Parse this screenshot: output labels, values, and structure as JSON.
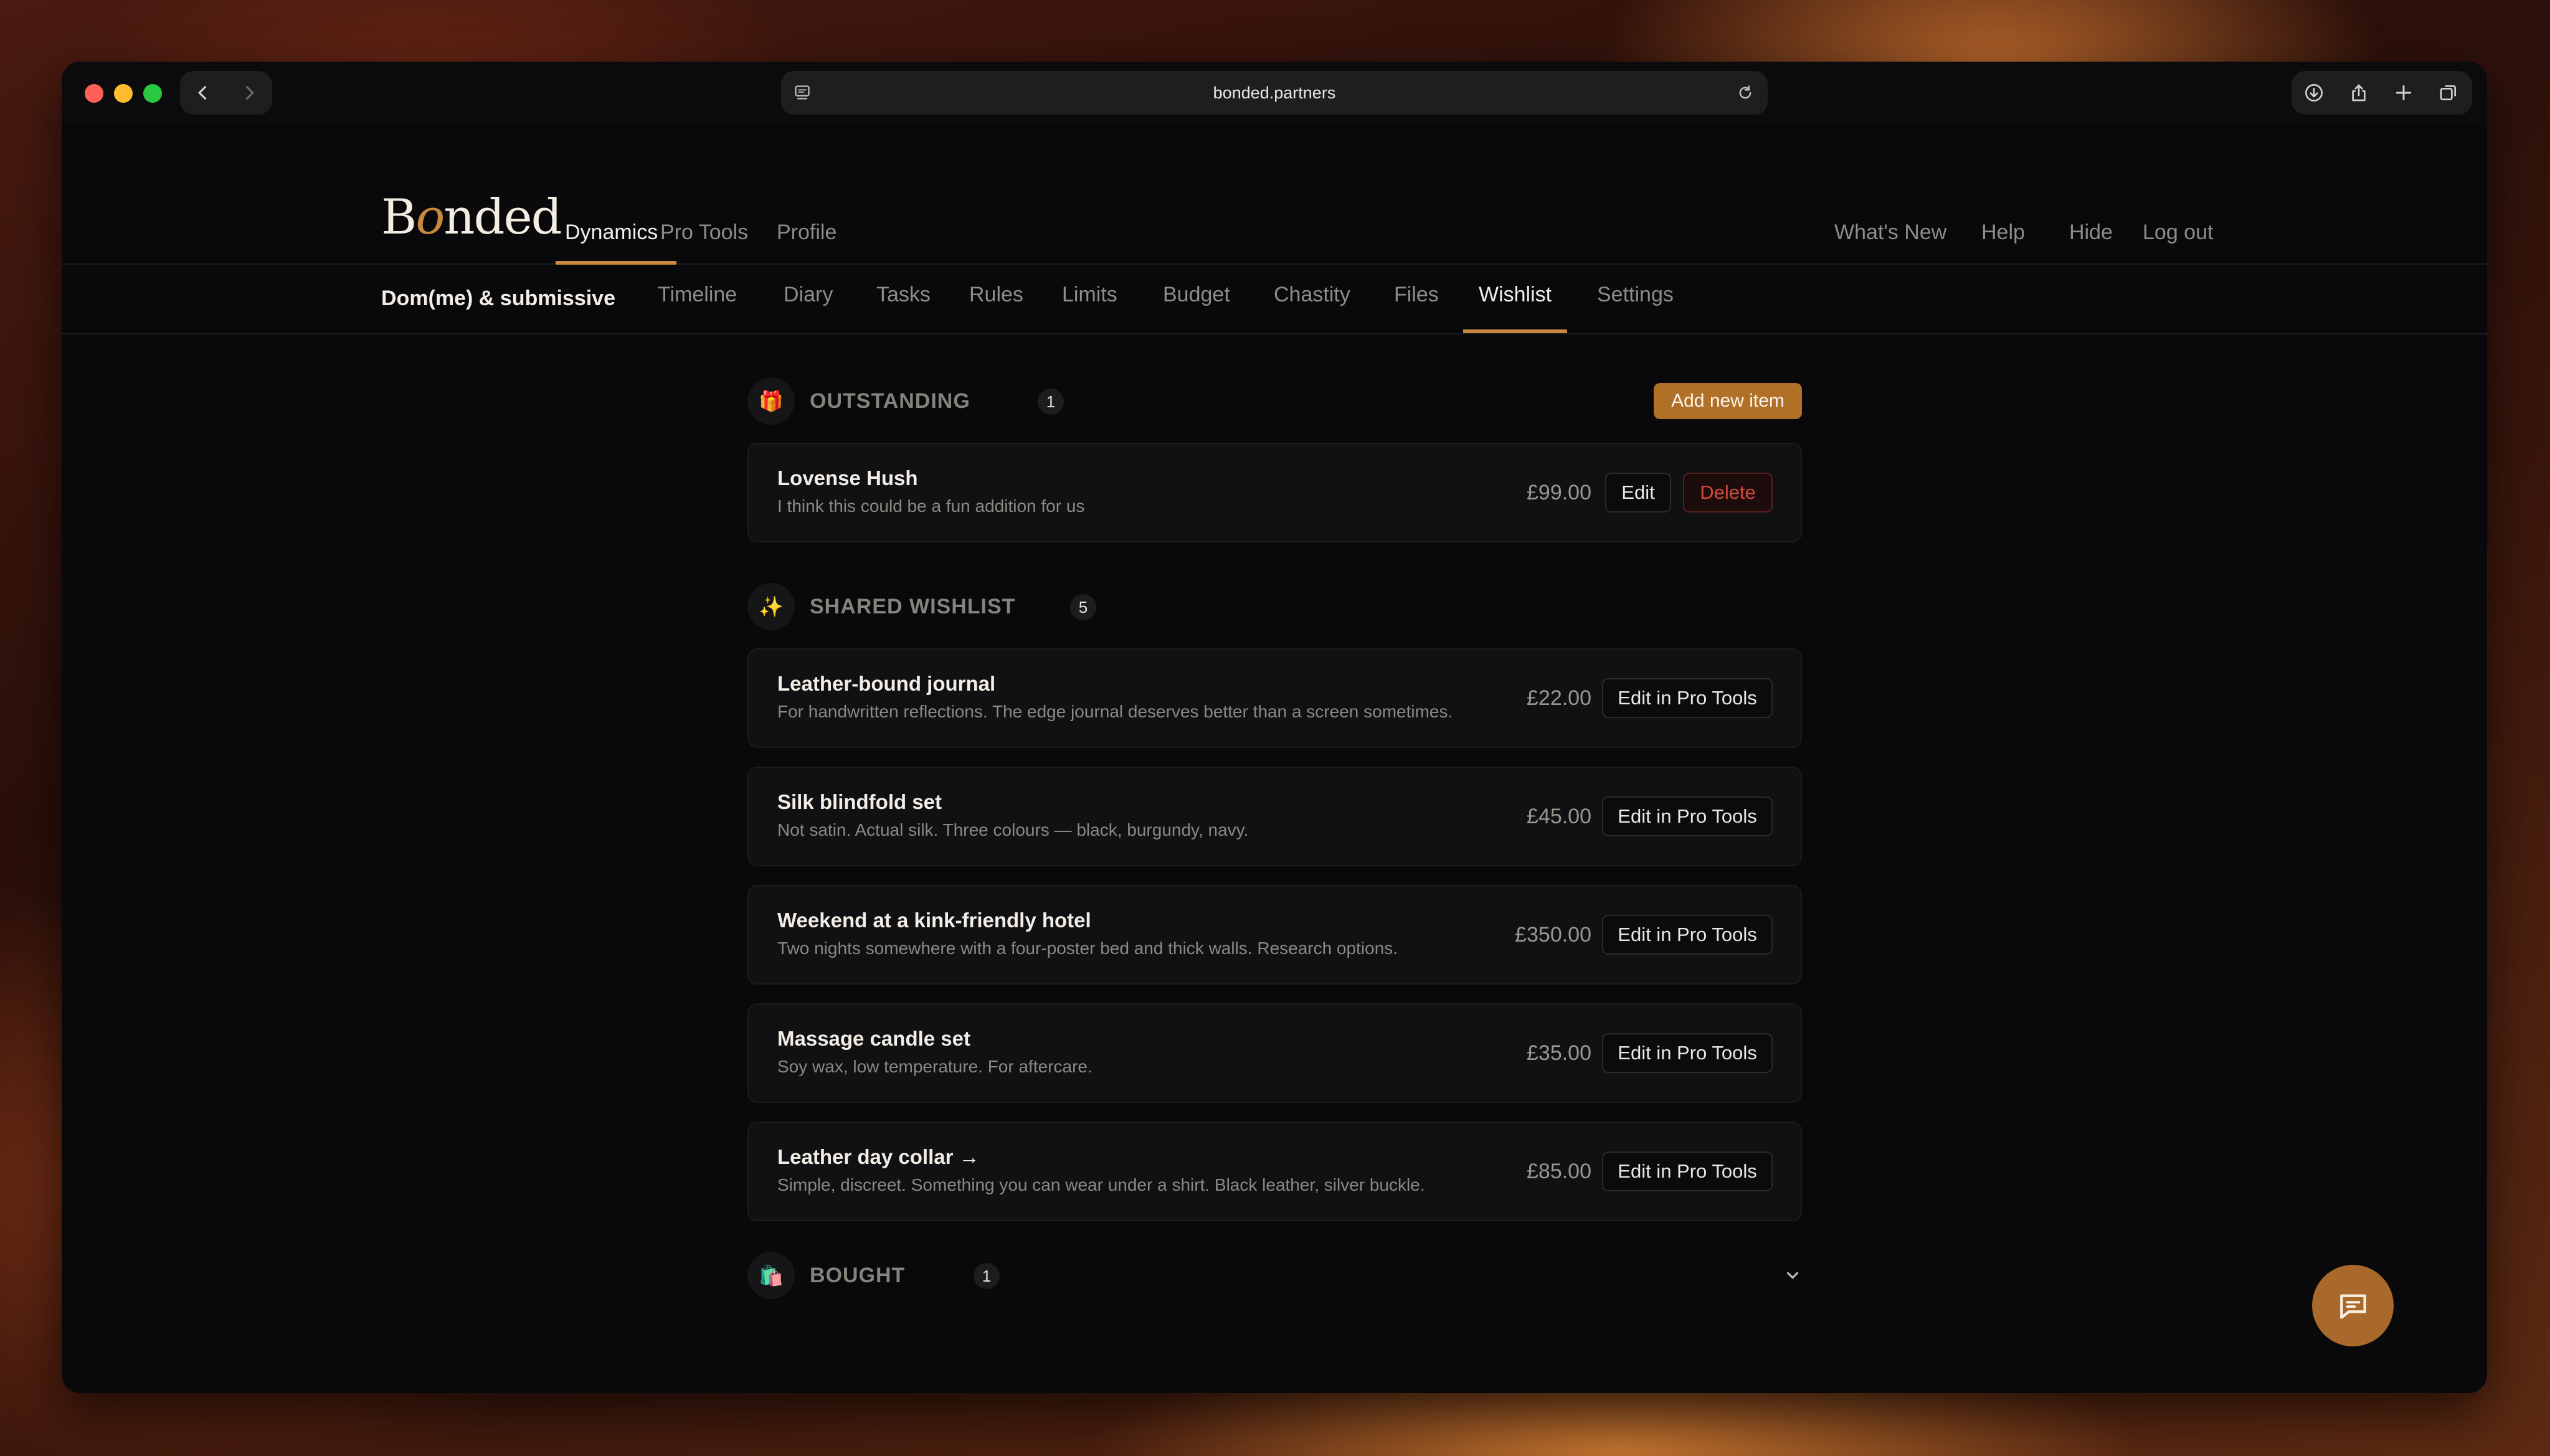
{
  "browser": {
    "url": "bonded.partners"
  },
  "header": {
    "logo_text": "Bonded",
    "nav": [
      {
        "label": "Dynamics",
        "active": true
      },
      {
        "label": "Pro Tools",
        "active": false
      },
      {
        "label": "Profile",
        "active": false
      }
    ],
    "right_nav": [
      "What's New",
      "Help",
      "Hide",
      "Log out"
    ]
  },
  "subnav": {
    "title": "Dom(me) & submissive",
    "tabs": [
      {
        "label": "Timeline",
        "active": false
      },
      {
        "label": "Diary",
        "active": false
      },
      {
        "label": "Tasks",
        "active": false
      },
      {
        "label": "Rules",
        "active": false
      },
      {
        "label": "Limits",
        "active": false
      },
      {
        "label": "Budget",
        "active": false
      },
      {
        "label": "Chastity",
        "active": false
      },
      {
        "label": "Files",
        "active": false
      },
      {
        "label": "Wishlist",
        "active": true
      },
      {
        "label": "Settings",
        "active": false
      }
    ]
  },
  "outstanding": {
    "icon": "🎁",
    "title": "OUTSTANDING",
    "count": "1",
    "add_label": "Add new item",
    "items": [
      {
        "name": "Lovense Hush",
        "desc": "I think this could be a fun addition for us",
        "price": "£99.00",
        "edit_label": "Edit",
        "delete_label": "Delete"
      }
    ]
  },
  "shared": {
    "icon": "✨",
    "title": "SHARED WISHLIST",
    "count": "5",
    "items": [
      {
        "name": "Leather-bound journal",
        "desc": "For handwritten reflections. The edge journal deserves better than a screen sometimes.",
        "price": "£22.00",
        "edit_label": "Edit in Pro Tools"
      },
      {
        "name": "Silk blindfold set",
        "desc": "Not satin. Actual silk. Three colours — black, burgundy, navy.",
        "price": "£45.00",
        "edit_label": "Edit in Pro Tools"
      },
      {
        "name": "Weekend at a kink-friendly hotel",
        "desc": "Two nights somewhere with a four-poster bed and thick walls. Research options.",
        "price": "£350.00",
        "edit_label": "Edit in Pro Tools"
      },
      {
        "name": "Massage candle set",
        "desc": "Soy wax, low temperature. For aftercare.",
        "price": "£35.00",
        "edit_label": "Edit in Pro Tools"
      },
      {
        "name": "Leather day collar →",
        "desc": "Simple, discreet. Something you can wear under a shirt. Black leather, silver buckle.",
        "price": "£85.00",
        "edit_label": "Edit in Pro Tools"
      }
    ]
  },
  "bought": {
    "icon": "🛍️",
    "title": "BOUGHT",
    "count": "1"
  },
  "colors": {
    "accent": "#c8893e",
    "button_accent": "#b07028",
    "background": "#09090b",
    "card": "#111113",
    "delete": "#cf4a3c"
  },
  "icons": [
    "back-chevron-icon",
    "forward-chevron-icon",
    "site-settings-icon",
    "reload-icon",
    "download-icon",
    "share-icon",
    "new-tab-icon",
    "tabs-overview-icon",
    "gift-icon",
    "sparkles-icon",
    "shopping-bags-icon",
    "chevron-down-icon",
    "chat-bubble-icon"
  ]
}
